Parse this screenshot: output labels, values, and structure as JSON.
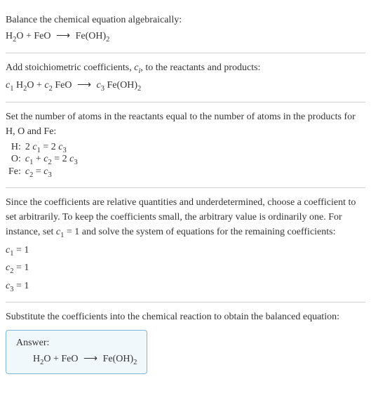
{
  "section1": {
    "intro": "Balance the chemical equation algebraically:",
    "eq_h2o": "H",
    "eq_o": "O + FeO",
    "eq_arrow": "⟶",
    "eq_feoh": "Fe(OH)",
    "sub2a": "2",
    "sub2b": "2"
  },
  "section2": {
    "intro_a": "Add stoichiometric coefficients, ",
    "ci": "c",
    "ci_sub": "i",
    "intro_b": ", to the reactants and products:",
    "c1": "c",
    "c1_sub": "1",
    "h2o_h": " H",
    "h2o_sub": "2",
    "h2o_o": "O + ",
    "c2": "c",
    "c2_sub": "2",
    "feo": " FeO",
    "arrow": "⟶",
    "c3": "c",
    "c3_sub": "3",
    "feoh": " Fe(OH)",
    "feoh_sub": "2"
  },
  "section3": {
    "intro": "Set the number of atoms in the reactants equal to the number of atoms in the products for H, O and Fe:",
    "rows": {
      "h_label": "H:",
      "h_eq_a": "2 ",
      "h_c1": "c",
      "h_c1s": "1",
      "h_eq_b": " = 2 ",
      "h_c3": "c",
      "h_c3s": "3",
      "o_label": "O:",
      "o_c1": "c",
      "o_c1s": "1",
      "o_plus": " + ",
      "o_c2": "c",
      "o_c2s": "2",
      "o_eq": " = 2 ",
      "o_c3": "c",
      "o_c3s": "3",
      "fe_label": "Fe:",
      "fe_c2": "c",
      "fe_c2s": "2",
      "fe_eq": " = ",
      "fe_c3": "c",
      "fe_c3s": "3"
    }
  },
  "section4": {
    "intro_a": "Since the coefficients are relative quantities and underdetermined, choose a coefficient to set arbitrarily. To keep the coefficients small, the arbitrary value is ordinarily one. For instance, set ",
    "c1": "c",
    "c1s": "1",
    "intro_b": " = 1 and solve the system of equations for the remaining coefficients:",
    "r1_c": "c",
    "r1_s": "1",
    "r1_v": " = 1",
    "r2_c": "c",
    "r2_s": "2",
    "r2_v": " = 1",
    "r3_c": "c",
    "r3_s": "3",
    "r3_v": " = 1"
  },
  "section5": {
    "intro": "Substitute the coefficients into the chemical reaction to obtain the balanced equation:",
    "answer_label": "Answer:",
    "eq_h2o_h": "H",
    "eq_h2o_sub": "2",
    "eq_rest": "O + FeO",
    "arrow": "⟶",
    "eq_feoh": "Fe(OH)",
    "eq_feoh_sub": "2"
  }
}
